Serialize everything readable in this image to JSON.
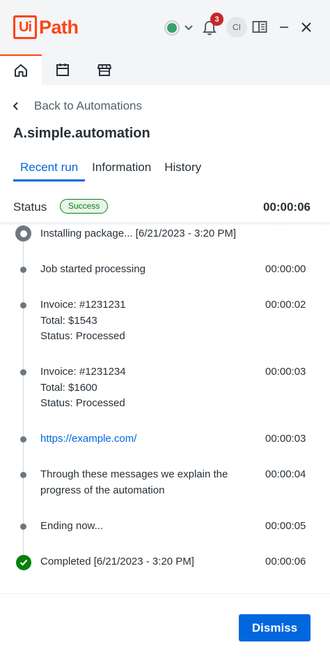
{
  "header": {
    "logo_mark": "Ui",
    "logo_text": "Path",
    "notification_count": "3",
    "avatar_initials": "CI",
    "connection_status_color": "#38a169",
    "brand_color": "#fa4616"
  },
  "nav": {
    "tabs": [
      {
        "icon": "home-icon",
        "active": true
      },
      {
        "icon": "calendar-icon",
        "active": false
      },
      {
        "icon": "store-icon",
        "active": false
      }
    ]
  },
  "page": {
    "back_label": "Back to Automations",
    "title": "A.simple.automation",
    "tabs": [
      {
        "label": "Recent run",
        "active": true
      },
      {
        "label": "Information",
        "active": false
      },
      {
        "label": "History",
        "active": false
      }
    ],
    "status_label": "Status",
    "status_value": "Success",
    "total_duration": "00:00:06"
  },
  "timeline": {
    "start": {
      "text": "Installing package... [6/21/2023 - 3:20 PM]"
    },
    "entries": [
      {
        "lines": [
          "Job started processing"
        ],
        "time": "00:00:00"
      },
      {
        "lines": [
          "Invoice: #1231231",
          "Total: $1543",
          "Status: Processed"
        ],
        "time": "00:00:02"
      },
      {
        "lines": [
          "Invoice: #1231234",
          "Total: $1600",
          "Status: Processed"
        ],
        "time": "00:00:03"
      },
      {
        "lines": [
          "https://example.com/"
        ],
        "time": "00:00:03",
        "is_link": true
      },
      {
        "lines": [
          "Through these messages we explain the",
          "progress of the automation"
        ],
        "time": "00:00:04"
      },
      {
        "lines": [
          "Ending now..."
        ],
        "time": "00:00:05"
      }
    ],
    "end": {
      "text": "Completed [6/21/2023 - 3:20 PM]",
      "time": "00:00:06"
    }
  },
  "footer": {
    "dismiss_label": "Dismiss",
    "accent_color": "#0067df"
  }
}
